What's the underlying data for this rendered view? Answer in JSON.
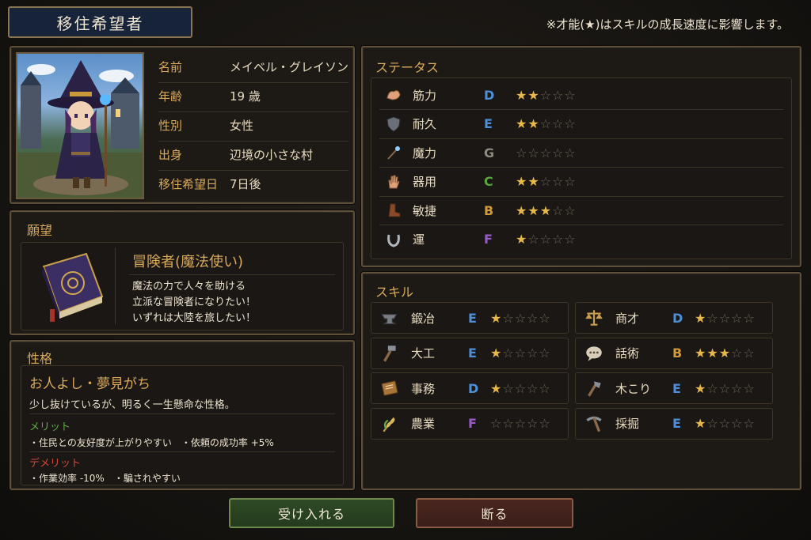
{
  "header": {
    "title": "移住希望者",
    "notice": "※才能(★)はスキルの成長速度に影響します。"
  },
  "profile": {
    "rows": [
      {
        "label": "名前",
        "value": "メイベル・グレイソン"
      },
      {
        "label": "年齢",
        "value": "19 歳"
      },
      {
        "label": "性別",
        "value": "女性"
      },
      {
        "label": "出身",
        "value": "辺境の小さな村"
      },
      {
        "label": "移住希望日",
        "value": "7日後"
      }
    ]
  },
  "wish": {
    "section_title": "願望",
    "heading": "冒険者(魔法使い)",
    "lines": [
      "魔法の力で人々を助ける",
      "立派な冒険者になりたい！",
      "いずれは大陸を旅したい！"
    ]
  },
  "personality": {
    "section_title": "性格",
    "trait": "お人よし・夢見がち",
    "description": "少し抜けているが、明るく一生懸命な性格。",
    "merit_label": "メリット",
    "merits": "・住民との友好度が上がりやすい　・依頼の成功率 +5%",
    "demerit_label": "デメリット",
    "demerits": "・作業効率 -10%　・騙されやすい"
  },
  "status": {
    "section_title": "ステータス",
    "items": [
      {
        "icon": "bicep-icon",
        "name": "筋力",
        "grade": "D",
        "grade_color": "#4f8fd8",
        "stars": 2
      },
      {
        "icon": "shield-icon",
        "name": "耐久",
        "grade": "E",
        "grade_color": "#4f8fd8",
        "stars": 2
      },
      {
        "icon": "wand-icon",
        "name": "魔力",
        "grade": "G",
        "grade_color": "#8f8a80",
        "stars": 0
      },
      {
        "icon": "hand-icon",
        "name": "器用",
        "grade": "C",
        "grade_color": "#58a83c",
        "stars": 2
      },
      {
        "icon": "boot-icon",
        "name": "敏捷",
        "grade": "B",
        "grade_color": "#d39a3c",
        "stars": 3
      },
      {
        "icon": "horseshoe-icon",
        "name": "運",
        "grade": "F",
        "grade_color": "#9a5ac8",
        "stars": 1
      }
    ]
  },
  "skills": {
    "section_title": "スキル",
    "items": [
      {
        "icon": "anvil-icon",
        "name": "鍛冶",
        "grade": "E",
        "grade_color": "#4f8fd8",
        "stars": 1
      },
      {
        "icon": "scales-icon",
        "name": "商才",
        "grade": "D",
        "grade_color": "#4f8fd8",
        "stars": 1
      },
      {
        "icon": "hammer-icon",
        "name": "大工",
        "grade": "E",
        "grade_color": "#4f8fd8",
        "stars": 1
      },
      {
        "icon": "speech-icon",
        "name": "話術",
        "grade": "B",
        "grade_color": "#d39a3c",
        "stars": 3
      },
      {
        "icon": "ledger-icon",
        "name": "事務",
        "grade": "D",
        "grade_color": "#4f8fd8",
        "stars": 1
      },
      {
        "icon": "axe-icon",
        "name": "木こり",
        "grade": "E",
        "grade_color": "#4f8fd8",
        "stars": 1
      },
      {
        "icon": "wheat-icon",
        "name": "農業",
        "grade": "F",
        "grade_color": "#9a5ac8",
        "stars": 0
      },
      {
        "icon": "pickaxe-icon",
        "name": "採掘",
        "grade": "E",
        "grade_color": "#4f8fd8",
        "stars": 1
      }
    ]
  },
  "buttons": {
    "accept": "受け入れる",
    "decline": "断る"
  }
}
